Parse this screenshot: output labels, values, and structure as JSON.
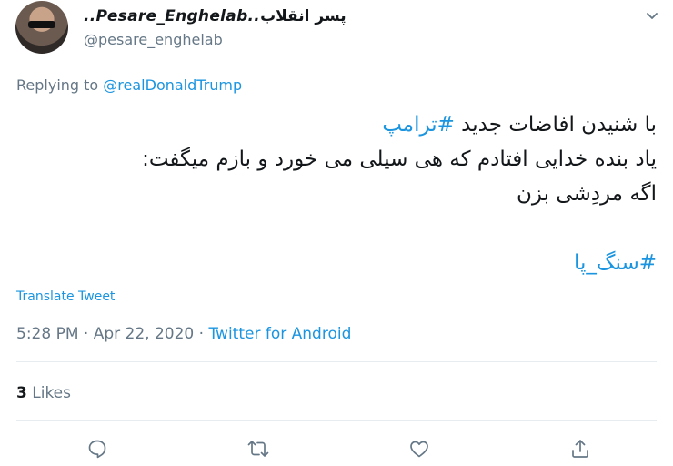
{
  "user": {
    "display_name_latin": "..Pesare_Enghelab..",
    "display_name_persian": "پسر انقلاب",
    "handle": "@pesare_enghelab"
  },
  "reply": {
    "prefix": "Replying to ",
    "mention": "@realDonaldTrump"
  },
  "tweet": {
    "line1_text": "با شنیدن افاضات جدید ",
    "line1_hashtag": "#ترامپ",
    "line2_text": "یاد بنده خدایی افتادم که هی سیلی می خورد و بازم میگفت:",
    "line3_text": "اگه مردِشی بزن",
    "hashtag2": "#سنگ_پا"
  },
  "translate_label": "Translate Tweet",
  "meta": {
    "time": "5:28 PM",
    "separator": " · ",
    "date": "Apr 22, 2020",
    "source": "Twitter for Android"
  },
  "stats": {
    "likes_count": "3",
    "likes_label": " Likes"
  },
  "icons": {
    "more": "chevron-down-icon",
    "reply": "reply-icon",
    "retweet": "retweet-icon",
    "like": "heart-icon",
    "share": "share-icon"
  },
  "colors": {
    "accent": "#1b95e0",
    "secondary": "#657786",
    "text": "#14171a",
    "divider": "#e6ecf0"
  }
}
